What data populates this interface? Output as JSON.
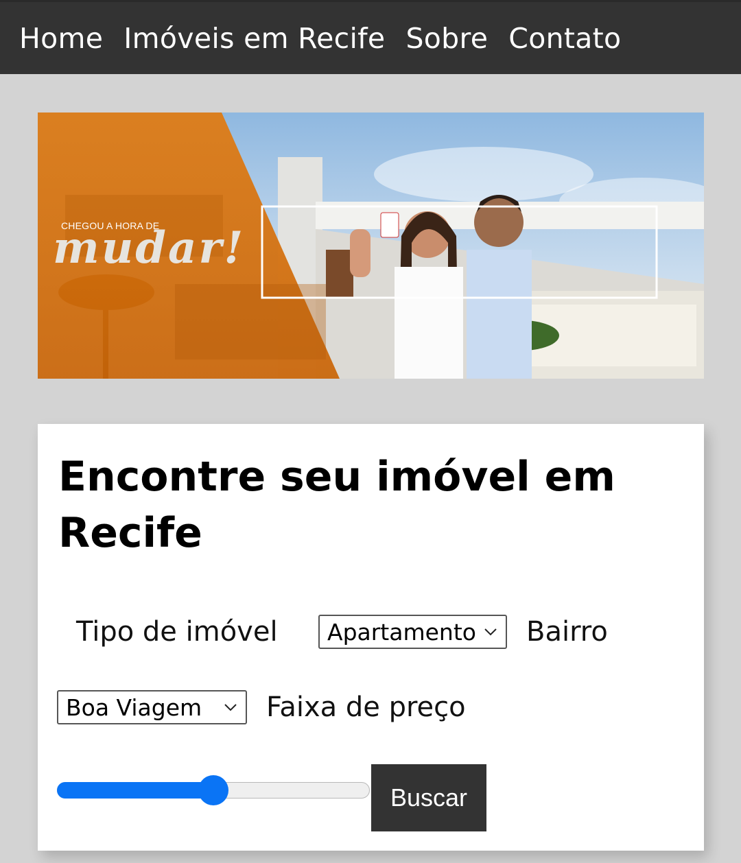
{
  "nav": {
    "items": [
      {
        "label": "Home"
      },
      {
        "label": "Imóveis em Recife"
      },
      {
        "label": "Sobre"
      },
      {
        "label": "Contato"
      }
    ]
  },
  "banner": {
    "small_text": "CHEGOU A HORA DE",
    "big_text": "mudar!",
    "accent_color": "#e8790f"
  },
  "search": {
    "title": "Encontre seu imóvel em Recife",
    "type_label": "Tipo de imóvel",
    "type_value": "Apartamento",
    "neighborhood_label": "Bairro",
    "neighborhood_value": "Boa Viagem",
    "price_label": "Faixa de preço",
    "price_level_fraction": 0.5,
    "button_label": "Buscar",
    "slider_color": "#0a74f5"
  }
}
